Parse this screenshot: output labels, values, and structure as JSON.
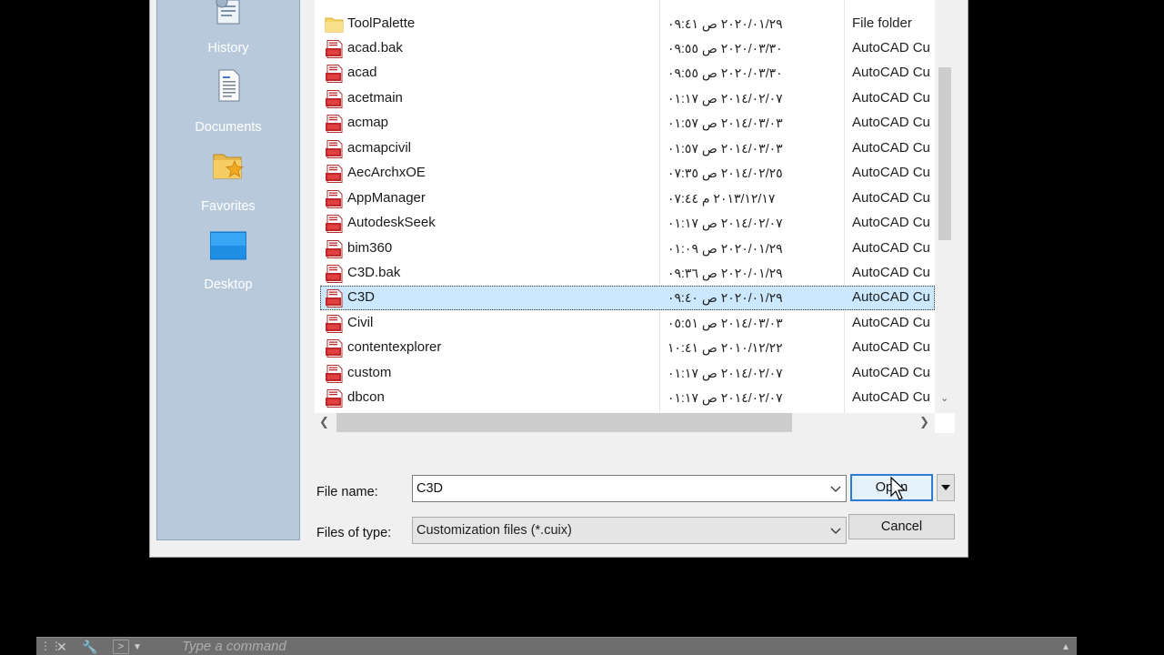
{
  "places": {
    "items": [
      {
        "label": "History",
        "icon": "history-icon"
      },
      {
        "label": "Documents",
        "icon": "documents-icon"
      },
      {
        "label": "Favorites",
        "icon": "favorites-icon"
      },
      {
        "label": "Desktop",
        "icon": "desktop-icon"
      }
    ]
  },
  "files": [
    {
      "name": "ToolPalette",
      "date": "٢٠٢٠/٠١/٢٩ ص ٠٩:٤١",
      "type": "File folder",
      "kind": "folder"
    },
    {
      "name": "acad.bak",
      "date": "٢٠٢٠/٠٣/٣٠ ص ٠٩:٥٥",
      "type": "AutoCAD Cu",
      "kind": "cuix"
    },
    {
      "name": "acad",
      "date": "٢٠٢٠/٠٣/٣٠ ص ٠٩:٥٥",
      "type": "AutoCAD Cu",
      "kind": "cuix"
    },
    {
      "name": "acetmain",
      "date": "٢٠١٤/٠٢/٠٧ ص ٠١:١٧",
      "type": "AutoCAD Cu",
      "kind": "cuix"
    },
    {
      "name": "acmap",
      "date": "٢٠١٤/٠٣/٠٣ ص ٠١:٥٧",
      "type": "AutoCAD Cu",
      "kind": "cuix"
    },
    {
      "name": "acmapcivil",
      "date": "٢٠١٤/٠٣/٠٣ ص ٠١:٥٧",
      "type": "AutoCAD Cu",
      "kind": "cuix"
    },
    {
      "name": "AecArchxOE",
      "date": "٢٠١٤/٠٢/٢٥ ص ٠٧:٣٥",
      "type": "AutoCAD Cu",
      "kind": "cuix"
    },
    {
      "name": "AppManager",
      "date": "٢٠١٣/١٢/١٧ م ٠٧:٤٤",
      "type": "AutoCAD Cu",
      "kind": "cuix"
    },
    {
      "name": "AutodeskSeek",
      "date": "٢٠١٤/٠٢/٠٧ ص ٠١:١٧",
      "type": "AutoCAD Cu",
      "kind": "cuix"
    },
    {
      "name": "bim360",
      "date": "٢٠٢٠/٠١/٢٩ ص ٠١:٠٩",
      "type": "AutoCAD Cu",
      "kind": "cuix"
    },
    {
      "name": "C3D.bak",
      "date": "٢٠٢٠/٠١/٢٩ ص ٠٩:٣٦",
      "type": "AutoCAD Cu",
      "kind": "cuix"
    },
    {
      "name": "C3D",
      "date": "٢٠٢٠/٠١/٢٩ ص ٠٩:٤٠",
      "type": "AutoCAD Cu",
      "kind": "cuix",
      "selected": true
    },
    {
      "name": "Civil",
      "date": "٢٠١٤/٠٣/٠٣ ص ٠٥:٥١",
      "type": "AutoCAD Cu",
      "kind": "cuix"
    },
    {
      "name": "contentexplorer",
      "date": "٢٠١٠/١٢/٢٢ ص ١٠:٤١",
      "type": "AutoCAD Cu",
      "kind": "cuix"
    },
    {
      "name": "custom",
      "date": "٢٠١٤/٠٢/٠٧ ص ٠١:١٧",
      "type": "AutoCAD Cu",
      "kind": "cuix"
    },
    {
      "name": "dbcon",
      "date": "٢٠١٤/٠٢/٠٧ ص ٠١:١٧",
      "type": "AutoCAD Cu",
      "kind": "cuix"
    }
  ],
  "form": {
    "filename_label": "File name:",
    "filename_value": "C3D",
    "filetype_label": "Files of type:",
    "filetype_value": "Customization files (*.cuix)",
    "open_label": "Open",
    "cancel_label": "Cancel"
  },
  "cmdbar": {
    "placeholder": "Type a command"
  },
  "colors": {
    "selection": "#cce8ff",
    "places_bg": "#b9c9dc",
    "primary_border": "#2e7bd6"
  }
}
